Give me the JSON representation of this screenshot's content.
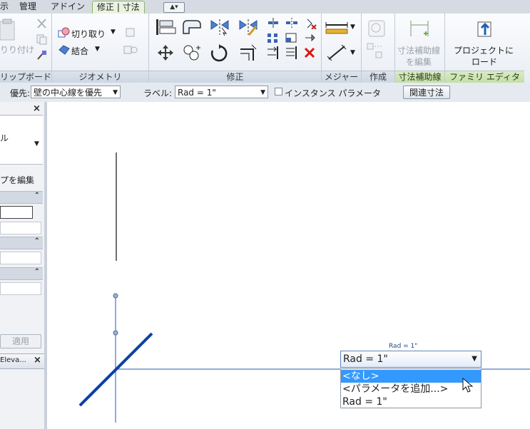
{
  "tabs": [
    {
      "label": "示",
      "active": false
    },
    {
      "label": "管理",
      "active": false
    },
    {
      "label": "アドイン",
      "active": false
    },
    {
      "label": "修正 | 寸法",
      "active": true
    }
  ],
  "ribbon": {
    "clipboard": {
      "title": "リップボード",
      "paste_label": "りり付け"
    },
    "geometry": {
      "title": "ジオメトリ",
      "cut_label": "切り取り",
      "join_label": "結合"
    },
    "modify": {
      "title": "修正"
    },
    "measure": {
      "title": "メジャー"
    },
    "create": {
      "title": "作成"
    },
    "witness": {
      "title": "寸法補助線",
      "edit_line1": "寸法補助線",
      "edit_line2": "を編集"
    },
    "family": {
      "title": "ファミリ エディタ",
      "load_line1": "プロジェクトに",
      "load_line2": "ロード"
    }
  },
  "options": {
    "prefer_label": "優先:",
    "prefer_value": "壁の中心線を優先",
    "label_label": "ラベル:",
    "label_value": "Rad = 1\"",
    "instance_param_label": "インスタンス パラメータ",
    "related_dim_button": "関連寸法"
  },
  "properties": {
    "close": "×",
    "type_fragment": "ル",
    "edit_type": "プを編集",
    "apply": "適用",
    "tab_label": "Eleva...",
    "tab_close": "×"
  },
  "canvas": {
    "dim_label": "Rad = 1\"",
    "combo_value": "Rad = 1\"",
    "options": [
      "<なし>",
      "<パラメータを追加...>",
      "Rad = 1\""
    ],
    "selected_index": 0
  },
  "colors": {
    "accent": "#3399ff",
    "line": "#0b3fa8",
    "tab_active": "#eaf3e0"
  }
}
